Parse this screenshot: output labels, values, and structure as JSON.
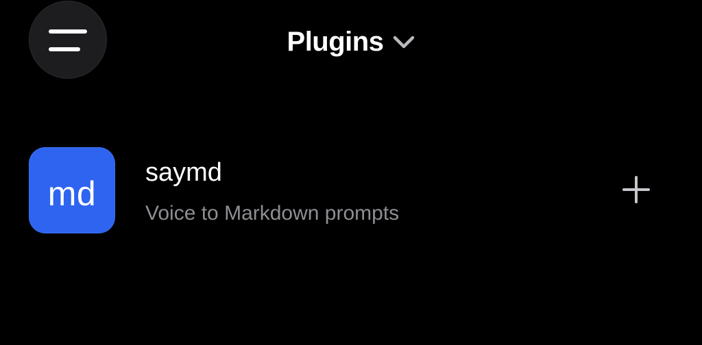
{
  "header": {
    "title": "Plugins",
    "menu_icon": "hamburger-menu-icon",
    "dropdown_icon": "chevron-down-icon"
  },
  "plugins": [
    {
      "logo_text": "md",
      "name": "saymd",
      "description": "Voice to Markdown prompts",
      "action_icon": "plus-icon"
    }
  ],
  "colors": {
    "background": "#000000",
    "menu_button": "#1d1d1f",
    "logo_background": "#2e64f0",
    "secondary_text": "#8e8e93",
    "plus_icon": "#c7c7cc"
  }
}
